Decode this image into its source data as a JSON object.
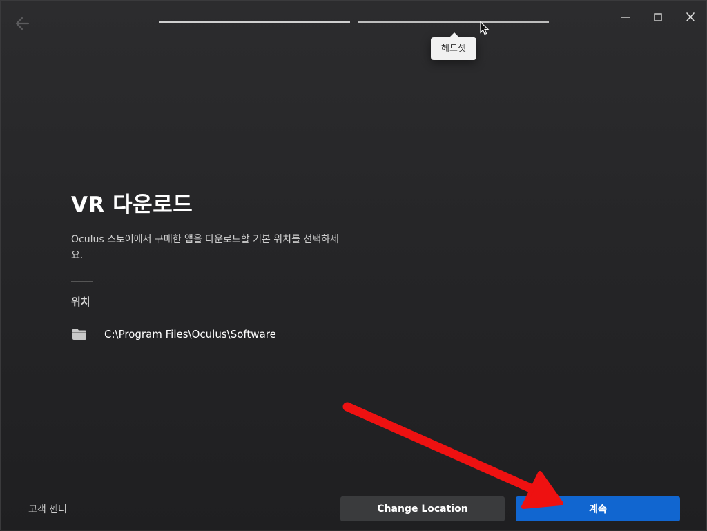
{
  "window": {
    "tooltip": "헤드셋",
    "icons": {
      "back": "arrow-left-icon",
      "minimize": "minimize-icon",
      "maximize": "maximize-icon",
      "close": "close-icon",
      "folder": "folder-icon",
      "cursor": "mouse-cursor-icon"
    }
  },
  "content": {
    "title": "VR 다운로드",
    "description": "Oculus 스토어에서 구매한 앱을 다운로드할 기본 위치를 선택하세요.",
    "location_label": "위치",
    "location_path": "C:\\Program Files\\Oculus\\Software"
  },
  "footer": {
    "support_link": "고객 센터",
    "change_location_label": "Change Location",
    "continue_label": "계속"
  },
  "colors": {
    "background": "#252527",
    "primary_button": "#1166d0",
    "secondary_button": "#3a3b3d",
    "annotation_arrow": "#ee1111"
  }
}
